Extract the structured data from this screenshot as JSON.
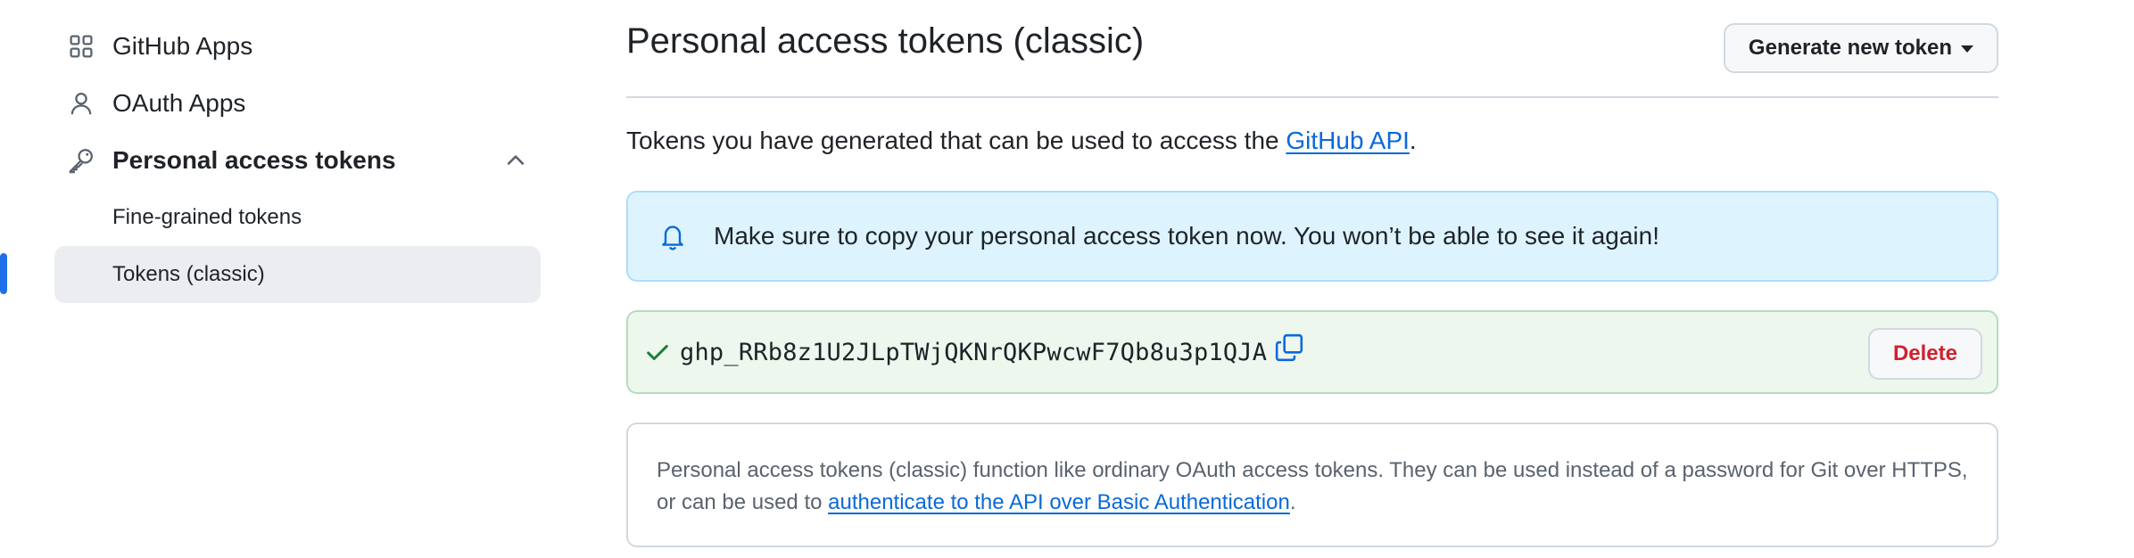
{
  "sidebar": {
    "items": [
      {
        "label": "GitHub Apps",
        "icon": "apps-grid-icon"
      },
      {
        "label": "OAuth Apps",
        "icon": "person-icon"
      },
      {
        "label": "Personal access tokens",
        "icon": "key-icon",
        "expanded": true
      }
    ],
    "sub_items": [
      {
        "label": "Fine-grained tokens",
        "active": false
      },
      {
        "label": "Tokens (classic)",
        "active": true
      }
    ],
    "accent_color": "#1f6feb"
  },
  "header": {
    "title": "Personal access tokens (classic)",
    "generate_button_label": "Generate new token"
  },
  "intro": {
    "text": "Tokens you have generated that can be used to access the ",
    "link_text": "GitHub API",
    "suffix": "."
  },
  "flash": {
    "icon": "bell-icon",
    "message": "Make sure to copy your personal access token now. You won’t be able to see it again!",
    "background": "#ddf4ff"
  },
  "token": {
    "value": "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",
    "status_icon": "check-icon",
    "copy_icon": "copy-icon",
    "delete_label": "Delete",
    "delete_color": "#cf222e",
    "background": "#eef7ed"
  },
  "note": {
    "text": "Personal access tokens (classic) function like ordinary OAuth access tokens. They can be used instead of a password for Git over HTTPS, or can be used to ",
    "link_text": "authenticate to the API over Basic Authentication",
    "suffix": "."
  }
}
